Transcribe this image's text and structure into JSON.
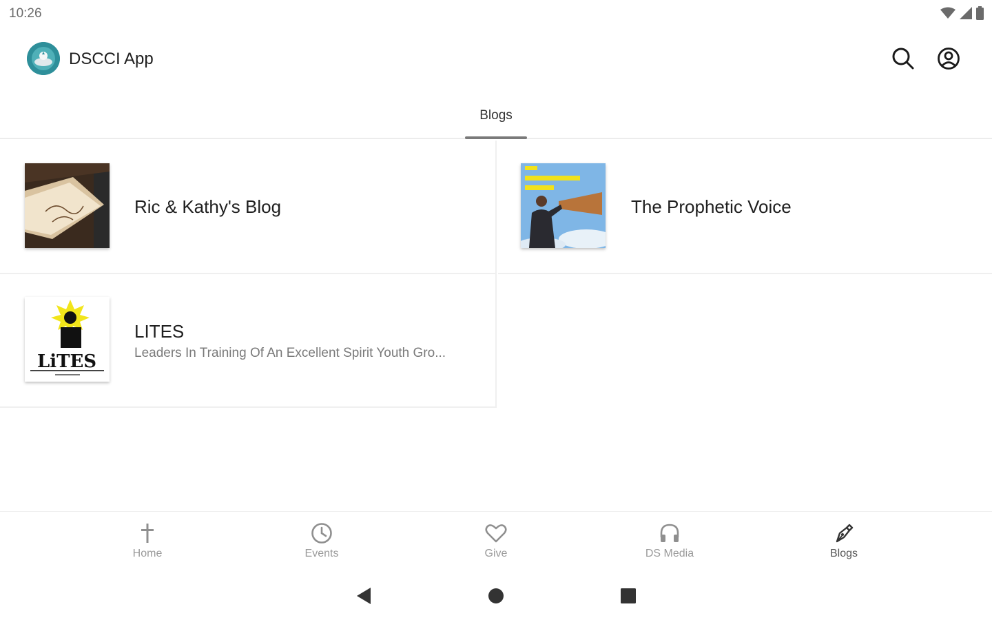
{
  "status_bar": {
    "time": "10:26",
    "icons": [
      "wifi-icon",
      "cell-signal-icon",
      "battery-icon"
    ]
  },
  "app_bar": {
    "title": "DSCCI App",
    "actions": [
      {
        "name": "search",
        "icon": "search-icon"
      },
      {
        "name": "account",
        "icon": "account-circle-icon"
      }
    ]
  },
  "tabs": [
    {
      "label": "Blogs",
      "selected": true
    }
  ],
  "blogs": [
    {
      "title": "Ric & Kathy's Blog",
      "subtitle": "",
      "thumbnail": "notebook-photo"
    },
    {
      "title": "The Prophetic Voice",
      "subtitle": "",
      "thumbnail": "megaphone-man-photo"
    },
    {
      "title": "LITES",
      "subtitle": "Leaders In Training Of An Excellent Spirit Youth Gro...",
      "thumbnail": "lites-logo"
    }
  ],
  "bottom_nav": {
    "items": [
      {
        "label": "Home",
        "icon": "cross-icon",
        "active": false
      },
      {
        "label": "Events",
        "icon": "clock-icon",
        "active": false
      },
      {
        "label": "Give",
        "icon": "heart-icon",
        "active": false
      },
      {
        "label": "DS Media",
        "icon": "headphones-icon",
        "active": false
      },
      {
        "label": "Blogs",
        "icon": "pen-nib-icon",
        "active": true
      }
    ]
  },
  "colors": {
    "accent_logo": "#2e8f9a",
    "tab_indicator": "#7a7a7a",
    "inactive_label": "#9a9a9a"
  }
}
